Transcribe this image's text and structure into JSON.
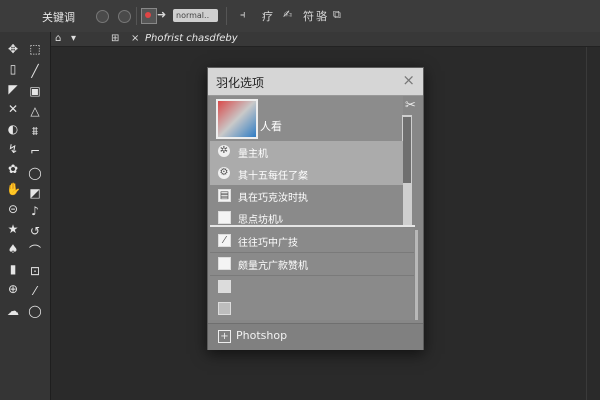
{
  "options_bar": {
    "label": "关键调",
    "field_text": "normal..",
    "icons": [
      "lasso-icon",
      "circle-icon",
      "record-icon",
      "arrow-right-icon",
      "align-icon",
      "grid-icon",
      "pen-check-icon",
      "transform-icon",
      "frame-icon"
    ],
    "text_1": "疗",
    "text_2": "符",
    "text_3": "骆"
  },
  "doc_tab": {
    "close_symbol": "×",
    "title": "Phofrist chasdfeby"
  },
  "toolbar": {
    "icons": [
      "move-icon",
      "marquee-icon",
      "lasso-icon",
      "brush-icon",
      "crop-icon",
      "eyedropper-icon",
      "close-x-icon",
      "heal-icon",
      "stamp-icon",
      "gradient-icon",
      "pen-icon",
      "text-icon",
      "shape-icon",
      "hand-icon",
      "zoom-icon",
      "star-icon",
      "dodge-icon",
      "smudge-icon",
      "color-swatch-icon"
    ]
  },
  "dialog": {
    "title": "羽化选项",
    "close_symbol": "×",
    "preview_label": "人看",
    "items": [
      {
        "label": "量主机",
        "icon": "settings-icon"
      },
      {
        "label": "其十五每任了粲",
        "icon": "gear-icon"
      },
      {
        "label": "具在巧克汝时执",
        "icon": "calendar-icon"
      },
      {
        "label": "思点坊机ﾙ",
        "icon": "checkbox-icon"
      }
    ],
    "lower_items": [
      {
        "label": "往往巧中广技",
        "icon": "checkbox-checked-icon"
      },
      {
        "label": "颇量亢广款赞机",
        "icon": "checkbox-icon"
      },
      {
        "label": "",
        "icon": "blank-swatch-icon"
      },
      {
        "label": "",
        "icon": "blank-swatch-icon"
      }
    ],
    "footer_label": "Photshop"
  },
  "colors": {
    "dialog_bg": "#878787",
    "title_bar": "#d6d6d6",
    "canvas": "#2a2a2a",
    "toolbar": "#353535"
  }
}
